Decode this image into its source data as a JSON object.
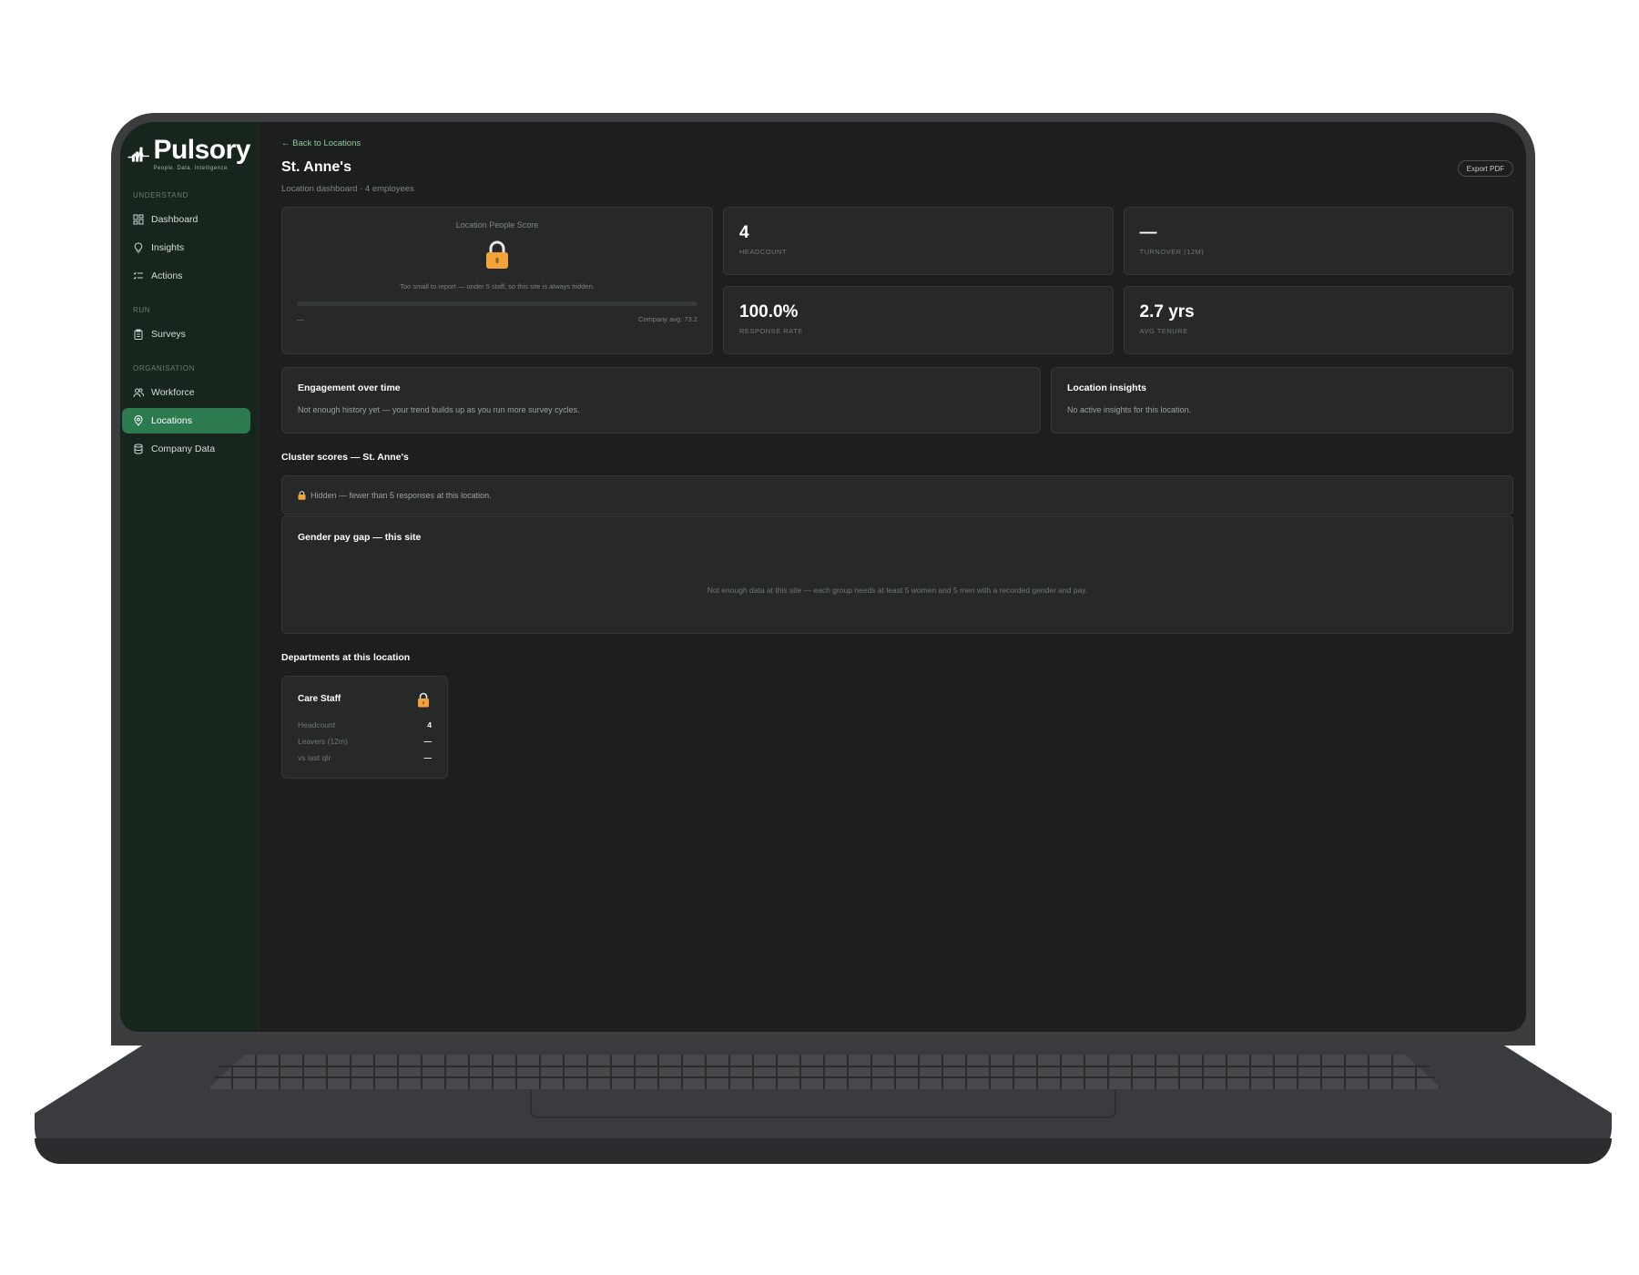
{
  "brand": {
    "name": "Pulsory",
    "tagline": "People. Data. Intelligence.",
    "accent": "#2e7a50",
    "lock_color": "#f2a33a"
  },
  "sidebar": {
    "sections": [
      {
        "label": "UNDERSTAND",
        "items": [
          {
            "label": "Dashboard",
            "icon": "dashboard-icon"
          },
          {
            "label": "Insights",
            "icon": "lightbulb-icon"
          },
          {
            "label": "Actions",
            "icon": "checklist-icon"
          }
        ]
      },
      {
        "label": "RUN",
        "items": [
          {
            "label": "Surveys",
            "icon": "clipboard-icon"
          }
        ]
      },
      {
        "label": "ORGANISATION",
        "items": [
          {
            "label": "Workforce",
            "icon": "users-icon"
          },
          {
            "label": "Locations",
            "icon": "map-pin-icon",
            "active": true
          },
          {
            "label": "Company Data",
            "icon": "database-icon"
          }
        ]
      }
    ]
  },
  "header": {
    "back": "← Back to Locations",
    "title": "St. Anne's",
    "subtitle": "Location dashboard · 4 employees",
    "export": "Export PDF"
  },
  "score": {
    "title": "Location People Score",
    "note": "Too small to report — under 5 staff, so this site is always hidden.",
    "left": "—",
    "right": "Company avg: 73.2"
  },
  "stats": {
    "headcount": {
      "value": "4",
      "label": "HEADCOUNT"
    },
    "turnover": {
      "value": "—",
      "label": "TURNOVER (12M)"
    },
    "response": {
      "value": "100.0%",
      "label": "RESPONSE RATE"
    },
    "tenure": {
      "value": "2.7 yrs",
      "label": "AVG TENURE"
    }
  },
  "engagement": {
    "title": "Engagement over time",
    "text": "Not enough history yet — your trend builds up as you run more survey cycles."
  },
  "insights": {
    "title": "Location insights",
    "text": "No active insights for this location."
  },
  "clusters": {
    "title": "Cluster scores — St. Anne's",
    "hidden": "Hidden — fewer than 5 responses at this location."
  },
  "paygap": {
    "title": "Gender pay gap — this site",
    "empty": "Not enough data at this site — each group needs at least 5 women and 5 men with a recorded gender and pay."
  },
  "departments": {
    "title": "Departments at this location",
    "items": [
      {
        "name": "Care Staff",
        "rows": [
          {
            "k": "Headcount",
            "v": "4"
          },
          {
            "k": "Leavers (12m)",
            "v": "—"
          },
          {
            "k": "vs last qtr",
            "v": "—"
          }
        ]
      }
    ]
  }
}
